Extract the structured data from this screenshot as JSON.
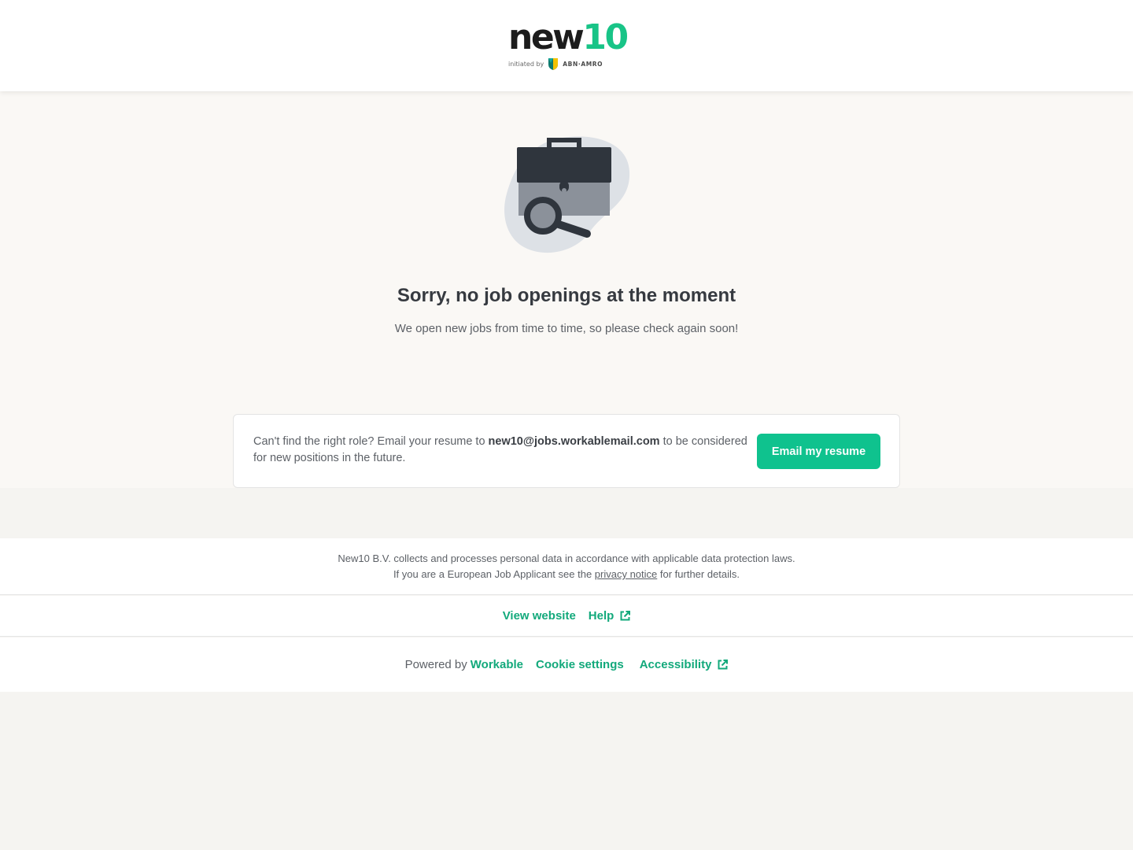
{
  "header": {
    "logo_main": "new",
    "logo_accent": "10",
    "logo_initiated": "initiated by",
    "logo_partner": "ABN·AMRO"
  },
  "hero": {
    "title": "Sorry, no job openings at the moment",
    "subtitle": "We open new jobs from time to time, so please check again soon!"
  },
  "card": {
    "text_before": "Can't find the right role? Email your resume to ",
    "email": "new10@jobs.workablemail.com",
    "text_after": " to be considered for new positions in the future.",
    "button_label": "Email my resume"
  },
  "footer": {
    "privacy_line1": "New10 B.V. collects and processes personal data in accordance with applicable data protection laws.",
    "privacy_line2_before": "If you are a European Job Applicant see the ",
    "privacy_link": "privacy notice",
    "privacy_line2_after": " for further details.",
    "links": {
      "view_website": "View website",
      "help": "Help"
    },
    "powered_by": "Powered by",
    "workable": "Workable",
    "cookie_settings": "Cookie settings",
    "accessibility": "Accessibility"
  },
  "colors": {
    "brand_green": "#18c487",
    "button_green": "#0fc28e",
    "link_green": "#12a97b",
    "page_bg": "#faf8f5"
  },
  "icons": {
    "illustration": "briefcase-search-icon",
    "external": "external-link-icon"
  }
}
